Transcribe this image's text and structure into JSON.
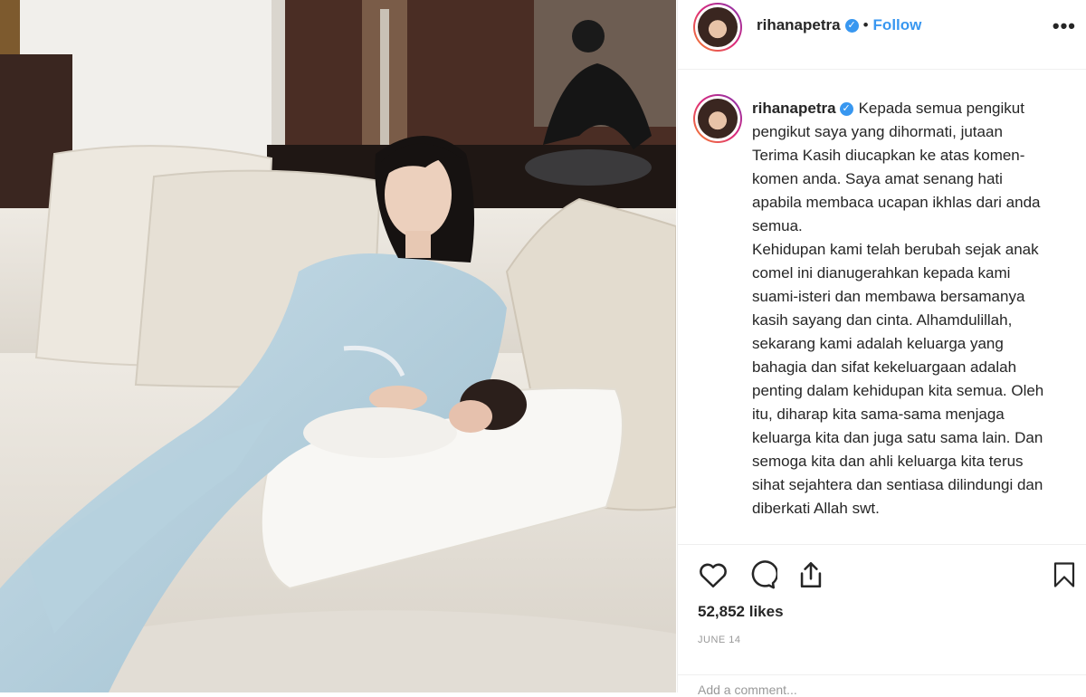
{
  "post": {
    "username": "rihanapetra",
    "follow_label": "Follow",
    "separator": "•",
    "more_label": "•••",
    "caption": "Kepada semua pengikut pengikut saya yang dihormati, jutaan Terima Kasih diucapkan ke atas komen-komen anda. Saya amat senang hati apabila membaca ucapan ikhlas dari anda semua.\nKehidupan kami telah berubah sejak anak comel ini dianugerahkan kepada kami suami-isteri dan membawa bersamanya kasih sayang dan cinta. Alhamdulillah, sekarang kami adalah keluarga yang bahagia dan sifat kekeluargaan adalah penting dalam kehidupan kita semua. Oleh itu, diharap kita sama-sama menjaga keluarga kita dan juga satu sama lain. Dan semoga kita dan ahli keluarga kita terus sihat sejahtera dan sentiasa dilindungi dan diberkati Allah swt.",
    "likes": "52,852 likes",
    "date": "JUNE 14",
    "comment_placeholder": "Add a comment..."
  },
  "icons": {
    "verified": "verified-badge-icon",
    "like": "heart-icon",
    "comment": "comment-bubble-icon",
    "share": "share-icon",
    "save": "bookmark-icon"
  },
  "colors": {
    "accent": "#3897f0",
    "text": "#262626",
    "muted": "#999999",
    "border": "#efefef"
  }
}
